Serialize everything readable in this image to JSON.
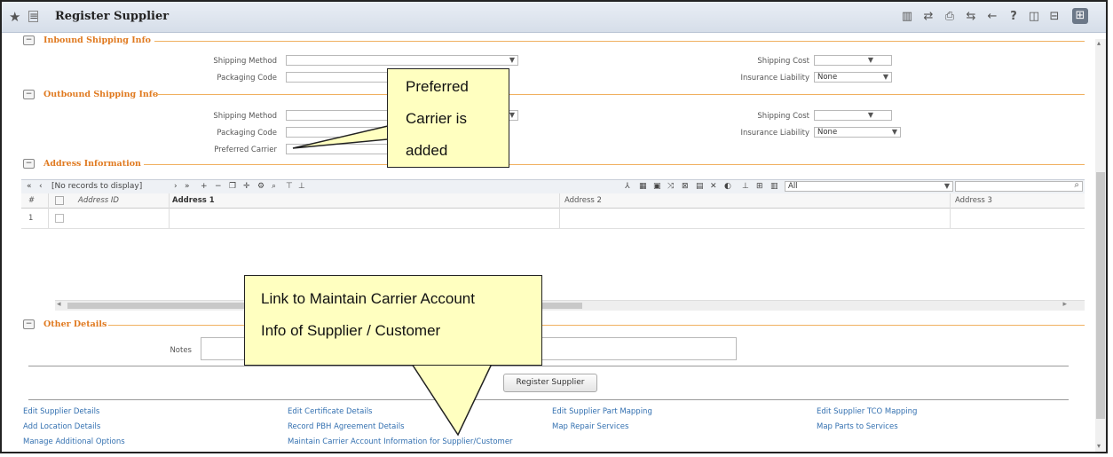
{
  "titlebar": {
    "title": "Register Supplier",
    "left_icons": [
      "star-icon",
      "document-icon"
    ],
    "right_icons": [
      "barcode-icon",
      "shuffle-icon",
      "print-icon",
      "swap-icon",
      "back-arrow-icon",
      "help-icon",
      "window-icon",
      "minimize-icon",
      "grid-icon"
    ]
  },
  "inbound": {
    "heading": "Inbound Shipping Info",
    "shipping_method_label": "Shipping Method",
    "packaging_code_label": "Packaging Code",
    "shipping_cost_label": "Shipping Cost",
    "insurance_label": "Insurance Liability",
    "insurance_value": "None"
  },
  "outbound": {
    "heading": "Outbound Shipping Info",
    "shipping_method_label": "Shipping Method",
    "packaging_code_label": "Packaging Code",
    "preferred_carrier_label": "Preferred Carrier",
    "shipping_cost_label": "Shipping Cost",
    "insurance_label": "Insurance Liability",
    "insurance_value": "None"
  },
  "address": {
    "heading": "Address Information",
    "records_text": "[No records to display]",
    "filter_value": "All",
    "columns": [
      "#",
      "Address ID",
      "Address 1",
      "Address 2",
      "Address 3"
    ],
    "row_number": "1"
  },
  "other": {
    "heading": "Other Details",
    "notes_label": "Notes"
  },
  "register_button": "Register Supplier",
  "links": [
    [
      "Edit Supplier Details",
      "Add Location Details",
      "Manage Additional Options"
    ],
    [
      "Edit Certificate Details",
      "Record PBH Agreement Details",
      "Maintain Carrier Account Information for Supplier/Customer"
    ],
    [
      "Edit Supplier Part Mapping",
      "Map Repair Services"
    ],
    [
      "Edit Supplier TCO Mapping",
      "Map Parts to Services"
    ]
  ],
  "callouts": {
    "preferred_carrier": [
      "Preferred",
      "Carrier is",
      "added"
    ],
    "carrier_link": [
      "Link to Maintain Carrier Account",
      "Info of Supplier / Customer"
    ]
  }
}
